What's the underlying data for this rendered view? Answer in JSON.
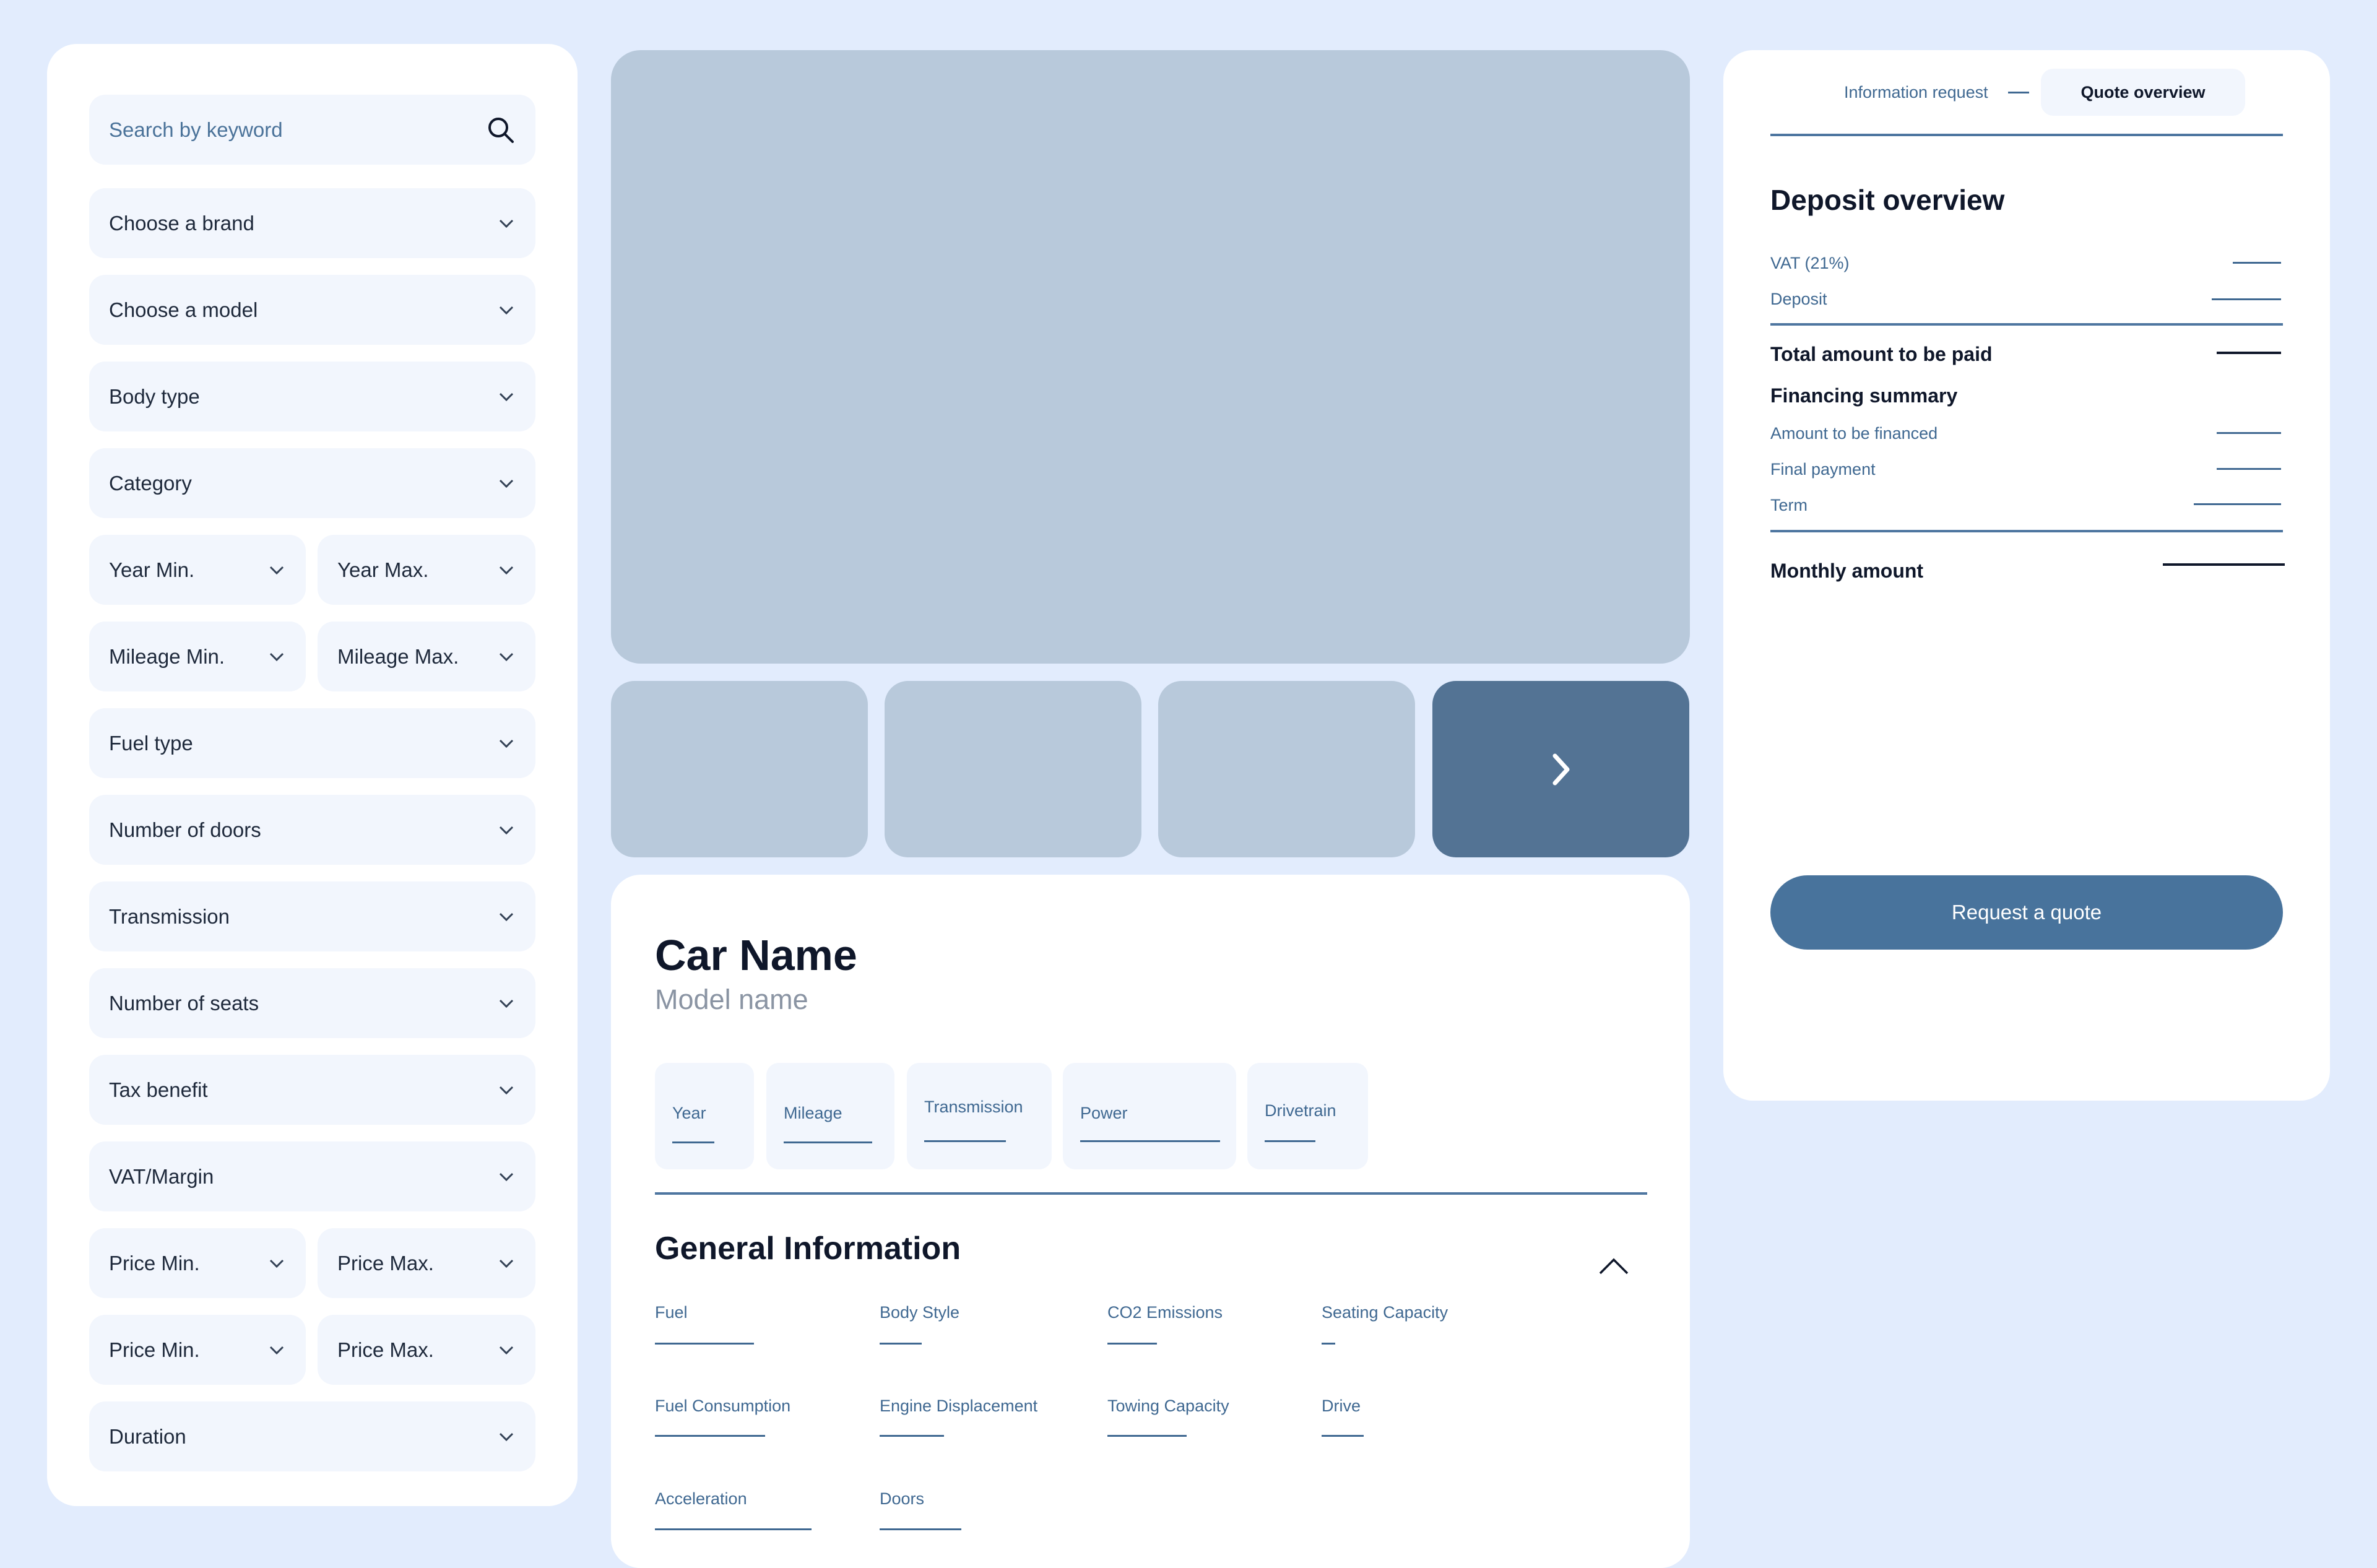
{
  "sidebar": {
    "search_placeholder": "Search by keyword",
    "filters": {
      "brand": "Choose a brand",
      "model": "Choose a model",
      "body_type": "Body type",
      "category": "Category",
      "year_min": "Year Min.",
      "year_max": "Year Max.",
      "mileage_min": "Mileage Min.",
      "mileage_max": "Mileage Max.",
      "fuel_type": "Fuel type",
      "doors": "Number of doors",
      "transmission": "Transmission",
      "seats": "Number of seats",
      "tax_benefit": "Tax benefit",
      "vat_margin": "VAT/Margin",
      "price_min_1": "Price Min.",
      "price_max_1": "Price Max.",
      "price_min_2": "Price Min.",
      "price_max_2": "Price Max.",
      "duration": "Duration"
    }
  },
  "details": {
    "car_name": "Car Name",
    "model_name": "Model name",
    "specs": {
      "year": "Year",
      "mileage": "Mileage",
      "transmission": "Transmission",
      "power": "Power",
      "drivetrain": "Drivetrain"
    },
    "general_title": "General Information",
    "general": {
      "fuel": "Fuel",
      "body_style": "Body Style",
      "co2": "CO2 Emissions",
      "seating": "Seating Capacity",
      "consumption": "Fuel Consumption",
      "displacement": "Engine Displacement",
      "towing": "Towing Capacity",
      "drive": "Drive",
      "acceleration": "Acceleration",
      "doors": "Doors"
    }
  },
  "quote": {
    "steps": {
      "info_request": "Information request",
      "quote_overview": "Quote overview"
    },
    "title": "Deposit overview",
    "vat": "VAT (21%)",
    "deposit": "Deposit",
    "total": "Total amount to be paid",
    "financing_title": "Financing summary",
    "financed": "Amount to be financed",
    "final_payment": "Final payment",
    "term": "Term",
    "monthly": "Monthly amount",
    "cta": "Request a quote"
  },
  "colors": {
    "background": "#e2ecfd",
    "field": "#f2f6fd",
    "placeholder_image": "#b8c9db",
    "accent": "#48739c",
    "accent_text": "#3f6891"
  },
  "icons": {
    "search": "search-icon",
    "dropdown": "chevron-down-icon",
    "next": "chevron-right-icon",
    "collapse": "chevron-up-icon"
  }
}
